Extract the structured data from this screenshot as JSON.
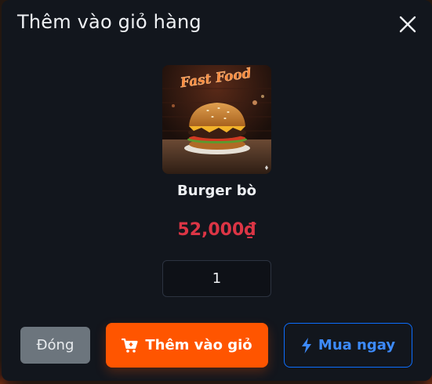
{
  "modal": {
    "title": "Thêm vào giỏ hàng"
  },
  "product": {
    "name": "Burger bò",
    "price": "52,000₫",
    "image_sign_text": "Fast Food"
  },
  "quantity": {
    "value": "1"
  },
  "actions": {
    "close_label": "Đóng",
    "add_to_cart_label": "Thêm vào giỏ",
    "buy_now_label": "Mua ngay"
  },
  "icons": {
    "close": "close-icon",
    "cart": "cart-plus-icon",
    "buy": "lightning-icon"
  },
  "colors": {
    "modal_bg": "#12161d",
    "price": "#dc3545",
    "primary_orange": "#ff5500",
    "accent_blue": "#0d6efd",
    "secondary_gray": "#6c757d"
  }
}
